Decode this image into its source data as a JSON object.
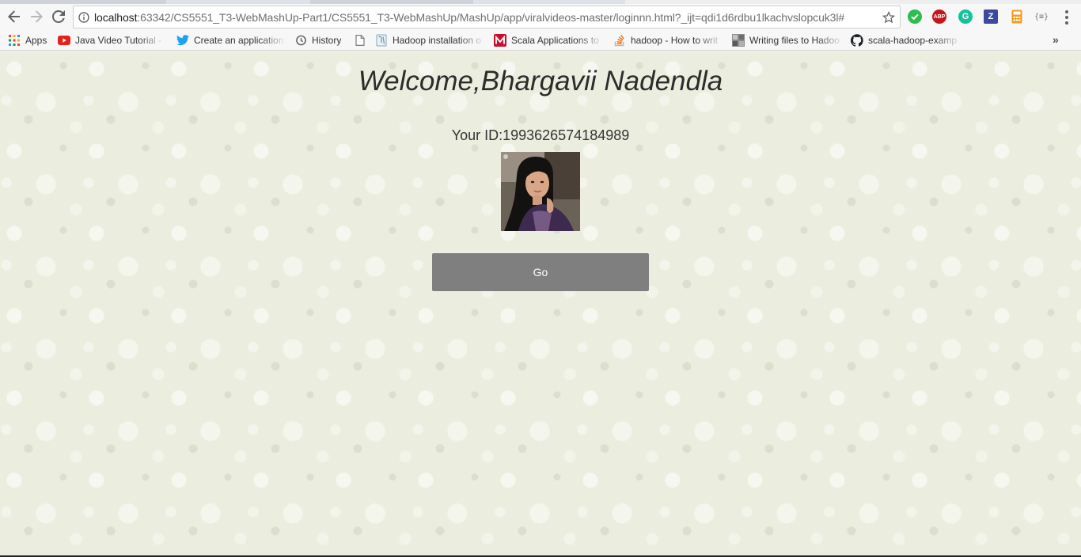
{
  "browser": {
    "url_host": "localhost",
    "url_path": ":63342/CS5551_T3-WebMashUp-Part1/CS5551_T3-WebMashUp/MashUp/app/viralvideos-master/loginnn.html?_ijt=qdi1d6rdbu1lkachvslopcuk3l#",
    "extensions": {
      "abp": "ABP",
      "grammarly": "G",
      "z": "Z",
      "json": "{≡}"
    }
  },
  "bookmarks": [
    {
      "label": "Apps",
      "icon": "apps-grid-icon"
    },
    {
      "label": "Java Video Tutorial -",
      "icon": "youtube-icon"
    },
    {
      "label": "Create an application",
      "icon": "twitter-bird-icon"
    },
    {
      "label": "History",
      "icon": "history-clock-icon"
    },
    {
      "label": "",
      "icon": "blank-page-icon"
    },
    {
      "label": "Hadoop installation o",
      "icon": "hadoop-elephant-icon"
    },
    {
      "label": "Scala Applications to",
      "icon": "mapr-logo-icon"
    },
    {
      "label": "hadoop - How to writ",
      "icon": "stackoverflow-icon"
    },
    {
      "label": "Writing files to Hadoo",
      "icon": "thumbnail-icon"
    },
    {
      "label": "scala-hadoop-examp",
      "icon": "github-icon"
    }
  ],
  "bookmarks_more": "»",
  "page": {
    "welcome": "Welcome,Bhargavii Nadendla",
    "user_id": "Your ID:1993626574184989",
    "go_button": "Go"
  },
  "colors": {
    "background": "#ebeedf",
    "button": "#7f7f7f",
    "button_text": "#ffffff"
  }
}
